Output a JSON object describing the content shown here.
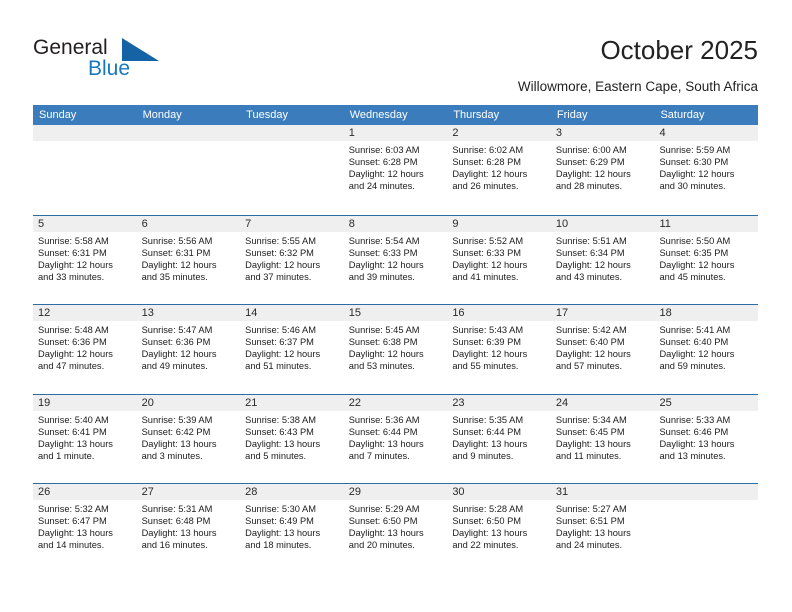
{
  "brand": {
    "name_part1": "General",
    "name_part2": "Blue"
  },
  "header": {
    "title": "October 2025",
    "subtitle": "Willowmore, Eastern Cape, South Africa"
  },
  "weekdays": [
    "Sunday",
    "Monday",
    "Tuesday",
    "Wednesday",
    "Thursday",
    "Friday",
    "Saturday"
  ],
  "colors": {
    "header_blue": "#3b7cbd",
    "separator_blue": "#2e6da4",
    "daynum_gray": "#efefef",
    "logo_blue": "#1878be"
  },
  "weeks": [
    [
      {
        "day": "",
        "empty": true
      },
      {
        "day": "",
        "empty": true
      },
      {
        "day": "",
        "empty": true
      },
      {
        "day": "1",
        "sunrise": "Sunrise: 6:03 AM",
        "sunset": "Sunset: 6:28 PM",
        "daylight1": "Daylight: 12 hours",
        "daylight2": "and 24 minutes."
      },
      {
        "day": "2",
        "sunrise": "Sunrise: 6:02 AM",
        "sunset": "Sunset: 6:28 PM",
        "daylight1": "Daylight: 12 hours",
        "daylight2": "and 26 minutes."
      },
      {
        "day": "3",
        "sunrise": "Sunrise: 6:00 AM",
        "sunset": "Sunset: 6:29 PM",
        "daylight1": "Daylight: 12 hours",
        "daylight2": "and 28 minutes."
      },
      {
        "day": "4",
        "sunrise": "Sunrise: 5:59 AM",
        "sunset": "Sunset: 6:30 PM",
        "daylight1": "Daylight: 12 hours",
        "daylight2": "and 30 minutes."
      }
    ],
    [
      {
        "day": "5",
        "sunrise": "Sunrise: 5:58 AM",
        "sunset": "Sunset: 6:31 PM",
        "daylight1": "Daylight: 12 hours",
        "daylight2": "and 33 minutes."
      },
      {
        "day": "6",
        "sunrise": "Sunrise: 5:56 AM",
        "sunset": "Sunset: 6:31 PM",
        "daylight1": "Daylight: 12 hours",
        "daylight2": "and 35 minutes."
      },
      {
        "day": "7",
        "sunrise": "Sunrise: 5:55 AM",
        "sunset": "Sunset: 6:32 PM",
        "daylight1": "Daylight: 12 hours",
        "daylight2": "and 37 minutes."
      },
      {
        "day": "8",
        "sunrise": "Sunrise: 5:54 AM",
        "sunset": "Sunset: 6:33 PM",
        "daylight1": "Daylight: 12 hours",
        "daylight2": "and 39 minutes."
      },
      {
        "day": "9",
        "sunrise": "Sunrise: 5:52 AM",
        "sunset": "Sunset: 6:33 PM",
        "daylight1": "Daylight: 12 hours",
        "daylight2": "and 41 minutes."
      },
      {
        "day": "10",
        "sunrise": "Sunrise: 5:51 AM",
        "sunset": "Sunset: 6:34 PM",
        "daylight1": "Daylight: 12 hours",
        "daylight2": "and 43 minutes."
      },
      {
        "day": "11",
        "sunrise": "Sunrise: 5:50 AM",
        "sunset": "Sunset: 6:35 PM",
        "daylight1": "Daylight: 12 hours",
        "daylight2": "and 45 minutes."
      }
    ],
    [
      {
        "day": "12",
        "sunrise": "Sunrise: 5:48 AM",
        "sunset": "Sunset: 6:36 PM",
        "daylight1": "Daylight: 12 hours",
        "daylight2": "and 47 minutes."
      },
      {
        "day": "13",
        "sunrise": "Sunrise: 5:47 AM",
        "sunset": "Sunset: 6:36 PM",
        "daylight1": "Daylight: 12 hours",
        "daylight2": "and 49 minutes."
      },
      {
        "day": "14",
        "sunrise": "Sunrise: 5:46 AM",
        "sunset": "Sunset: 6:37 PM",
        "daylight1": "Daylight: 12 hours",
        "daylight2": "and 51 minutes."
      },
      {
        "day": "15",
        "sunrise": "Sunrise: 5:45 AM",
        "sunset": "Sunset: 6:38 PM",
        "daylight1": "Daylight: 12 hours",
        "daylight2": "and 53 minutes."
      },
      {
        "day": "16",
        "sunrise": "Sunrise: 5:43 AM",
        "sunset": "Sunset: 6:39 PM",
        "daylight1": "Daylight: 12 hours",
        "daylight2": "and 55 minutes."
      },
      {
        "day": "17",
        "sunrise": "Sunrise: 5:42 AM",
        "sunset": "Sunset: 6:40 PM",
        "daylight1": "Daylight: 12 hours",
        "daylight2": "and 57 minutes."
      },
      {
        "day": "18",
        "sunrise": "Sunrise: 5:41 AM",
        "sunset": "Sunset: 6:40 PM",
        "daylight1": "Daylight: 12 hours",
        "daylight2": "and 59 minutes."
      }
    ],
    [
      {
        "day": "19",
        "sunrise": "Sunrise: 5:40 AM",
        "sunset": "Sunset: 6:41 PM",
        "daylight1": "Daylight: 13 hours",
        "daylight2": "and 1 minute."
      },
      {
        "day": "20",
        "sunrise": "Sunrise: 5:39 AM",
        "sunset": "Sunset: 6:42 PM",
        "daylight1": "Daylight: 13 hours",
        "daylight2": "and 3 minutes."
      },
      {
        "day": "21",
        "sunrise": "Sunrise: 5:38 AM",
        "sunset": "Sunset: 6:43 PM",
        "daylight1": "Daylight: 13 hours",
        "daylight2": "and 5 minutes."
      },
      {
        "day": "22",
        "sunrise": "Sunrise: 5:36 AM",
        "sunset": "Sunset: 6:44 PM",
        "daylight1": "Daylight: 13 hours",
        "daylight2": "and 7 minutes."
      },
      {
        "day": "23",
        "sunrise": "Sunrise: 5:35 AM",
        "sunset": "Sunset: 6:44 PM",
        "daylight1": "Daylight: 13 hours",
        "daylight2": "and 9 minutes."
      },
      {
        "day": "24",
        "sunrise": "Sunrise: 5:34 AM",
        "sunset": "Sunset: 6:45 PM",
        "daylight1": "Daylight: 13 hours",
        "daylight2": "and 11 minutes."
      },
      {
        "day": "25",
        "sunrise": "Sunrise: 5:33 AM",
        "sunset": "Sunset: 6:46 PM",
        "daylight1": "Daylight: 13 hours",
        "daylight2": "and 13 minutes."
      }
    ],
    [
      {
        "day": "26",
        "sunrise": "Sunrise: 5:32 AM",
        "sunset": "Sunset: 6:47 PM",
        "daylight1": "Daylight: 13 hours",
        "daylight2": "and 14 minutes."
      },
      {
        "day": "27",
        "sunrise": "Sunrise: 5:31 AM",
        "sunset": "Sunset: 6:48 PM",
        "daylight1": "Daylight: 13 hours",
        "daylight2": "and 16 minutes."
      },
      {
        "day": "28",
        "sunrise": "Sunrise: 5:30 AM",
        "sunset": "Sunset: 6:49 PM",
        "daylight1": "Daylight: 13 hours",
        "daylight2": "and 18 minutes."
      },
      {
        "day": "29",
        "sunrise": "Sunrise: 5:29 AM",
        "sunset": "Sunset: 6:50 PM",
        "daylight1": "Daylight: 13 hours",
        "daylight2": "and 20 minutes."
      },
      {
        "day": "30",
        "sunrise": "Sunrise: 5:28 AM",
        "sunset": "Sunset: 6:50 PM",
        "daylight1": "Daylight: 13 hours",
        "daylight2": "and 22 minutes."
      },
      {
        "day": "31",
        "sunrise": "Sunrise: 5:27 AM",
        "sunset": "Sunset: 6:51 PM",
        "daylight1": "Daylight: 13 hours",
        "daylight2": "and 24 minutes."
      },
      {
        "day": "",
        "empty": true
      }
    ]
  ]
}
